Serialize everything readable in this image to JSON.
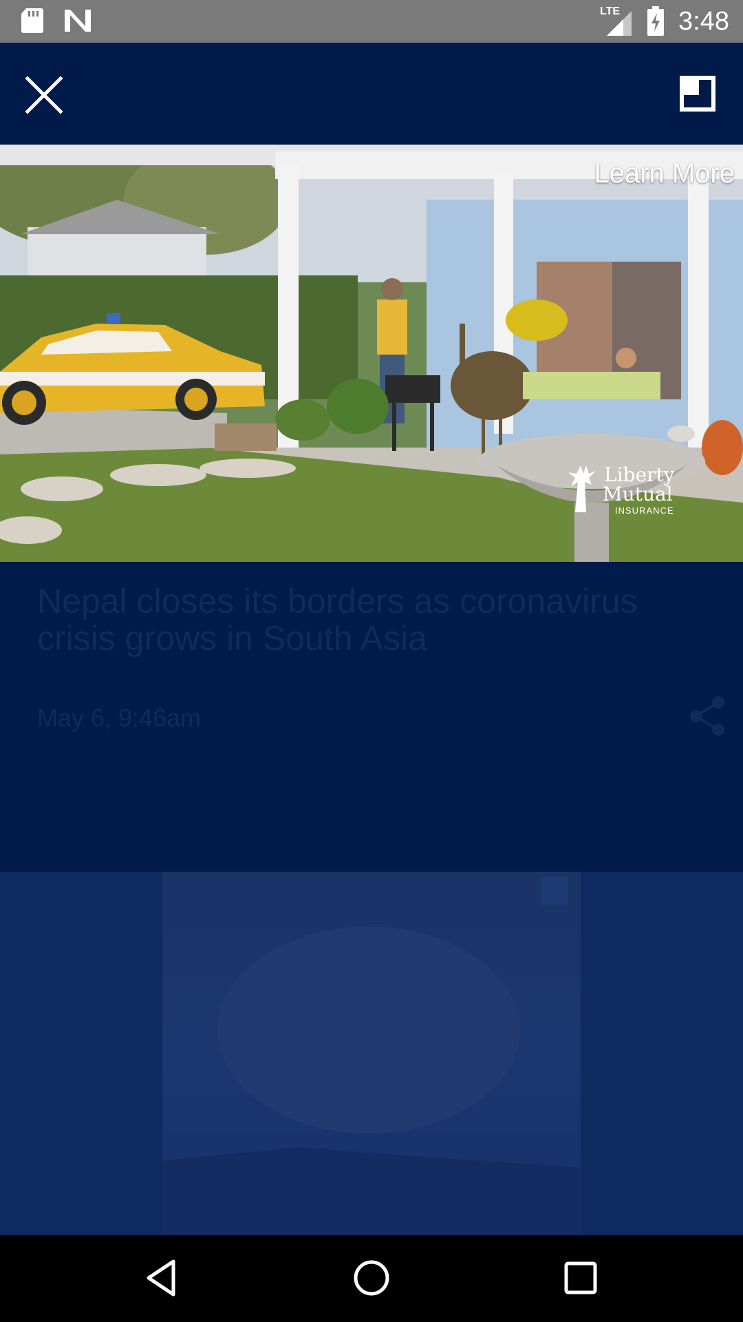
{
  "status_bar": {
    "time": "3:48",
    "network": "LTE",
    "icons": [
      "sd-card-icon",
      "n-logo-icon",
      "lte-signal-icon",
      "battery-charging-icon"
    ]
  },
  "app_bar": {
    "close_icon": "close-icon",
    "pip_icon": "picture-in-picture-icon"
  },
  "video_ad": {
    "cta_label": "Learn More",
    "advertiser_logo_line1": "Liberty",
    "advertiser_logo_line2": "Mutual",
    "advertiser_logo_tag": "INSURANCE"
  },
  "article": {
    "headline": "Nepal closes its borders as coronavirus crisis grows in South Asia",
    "timestamp": "May 6, 9:46am",
    "share_icon": "share-icon"
  },
  "nav_bar": {
    "back_icon": "back-triangle-icon",
    "home_icon": "home-circle-icon",
    "recents_icon": "recents-square-icon"
  },
  "colors": {
    "status_bar": "#7a7a7a",
    "app_background": "#011a4a",
    "dimmed_text": "#102a5e",
    "nav_bar": "#000000"
  }
}
